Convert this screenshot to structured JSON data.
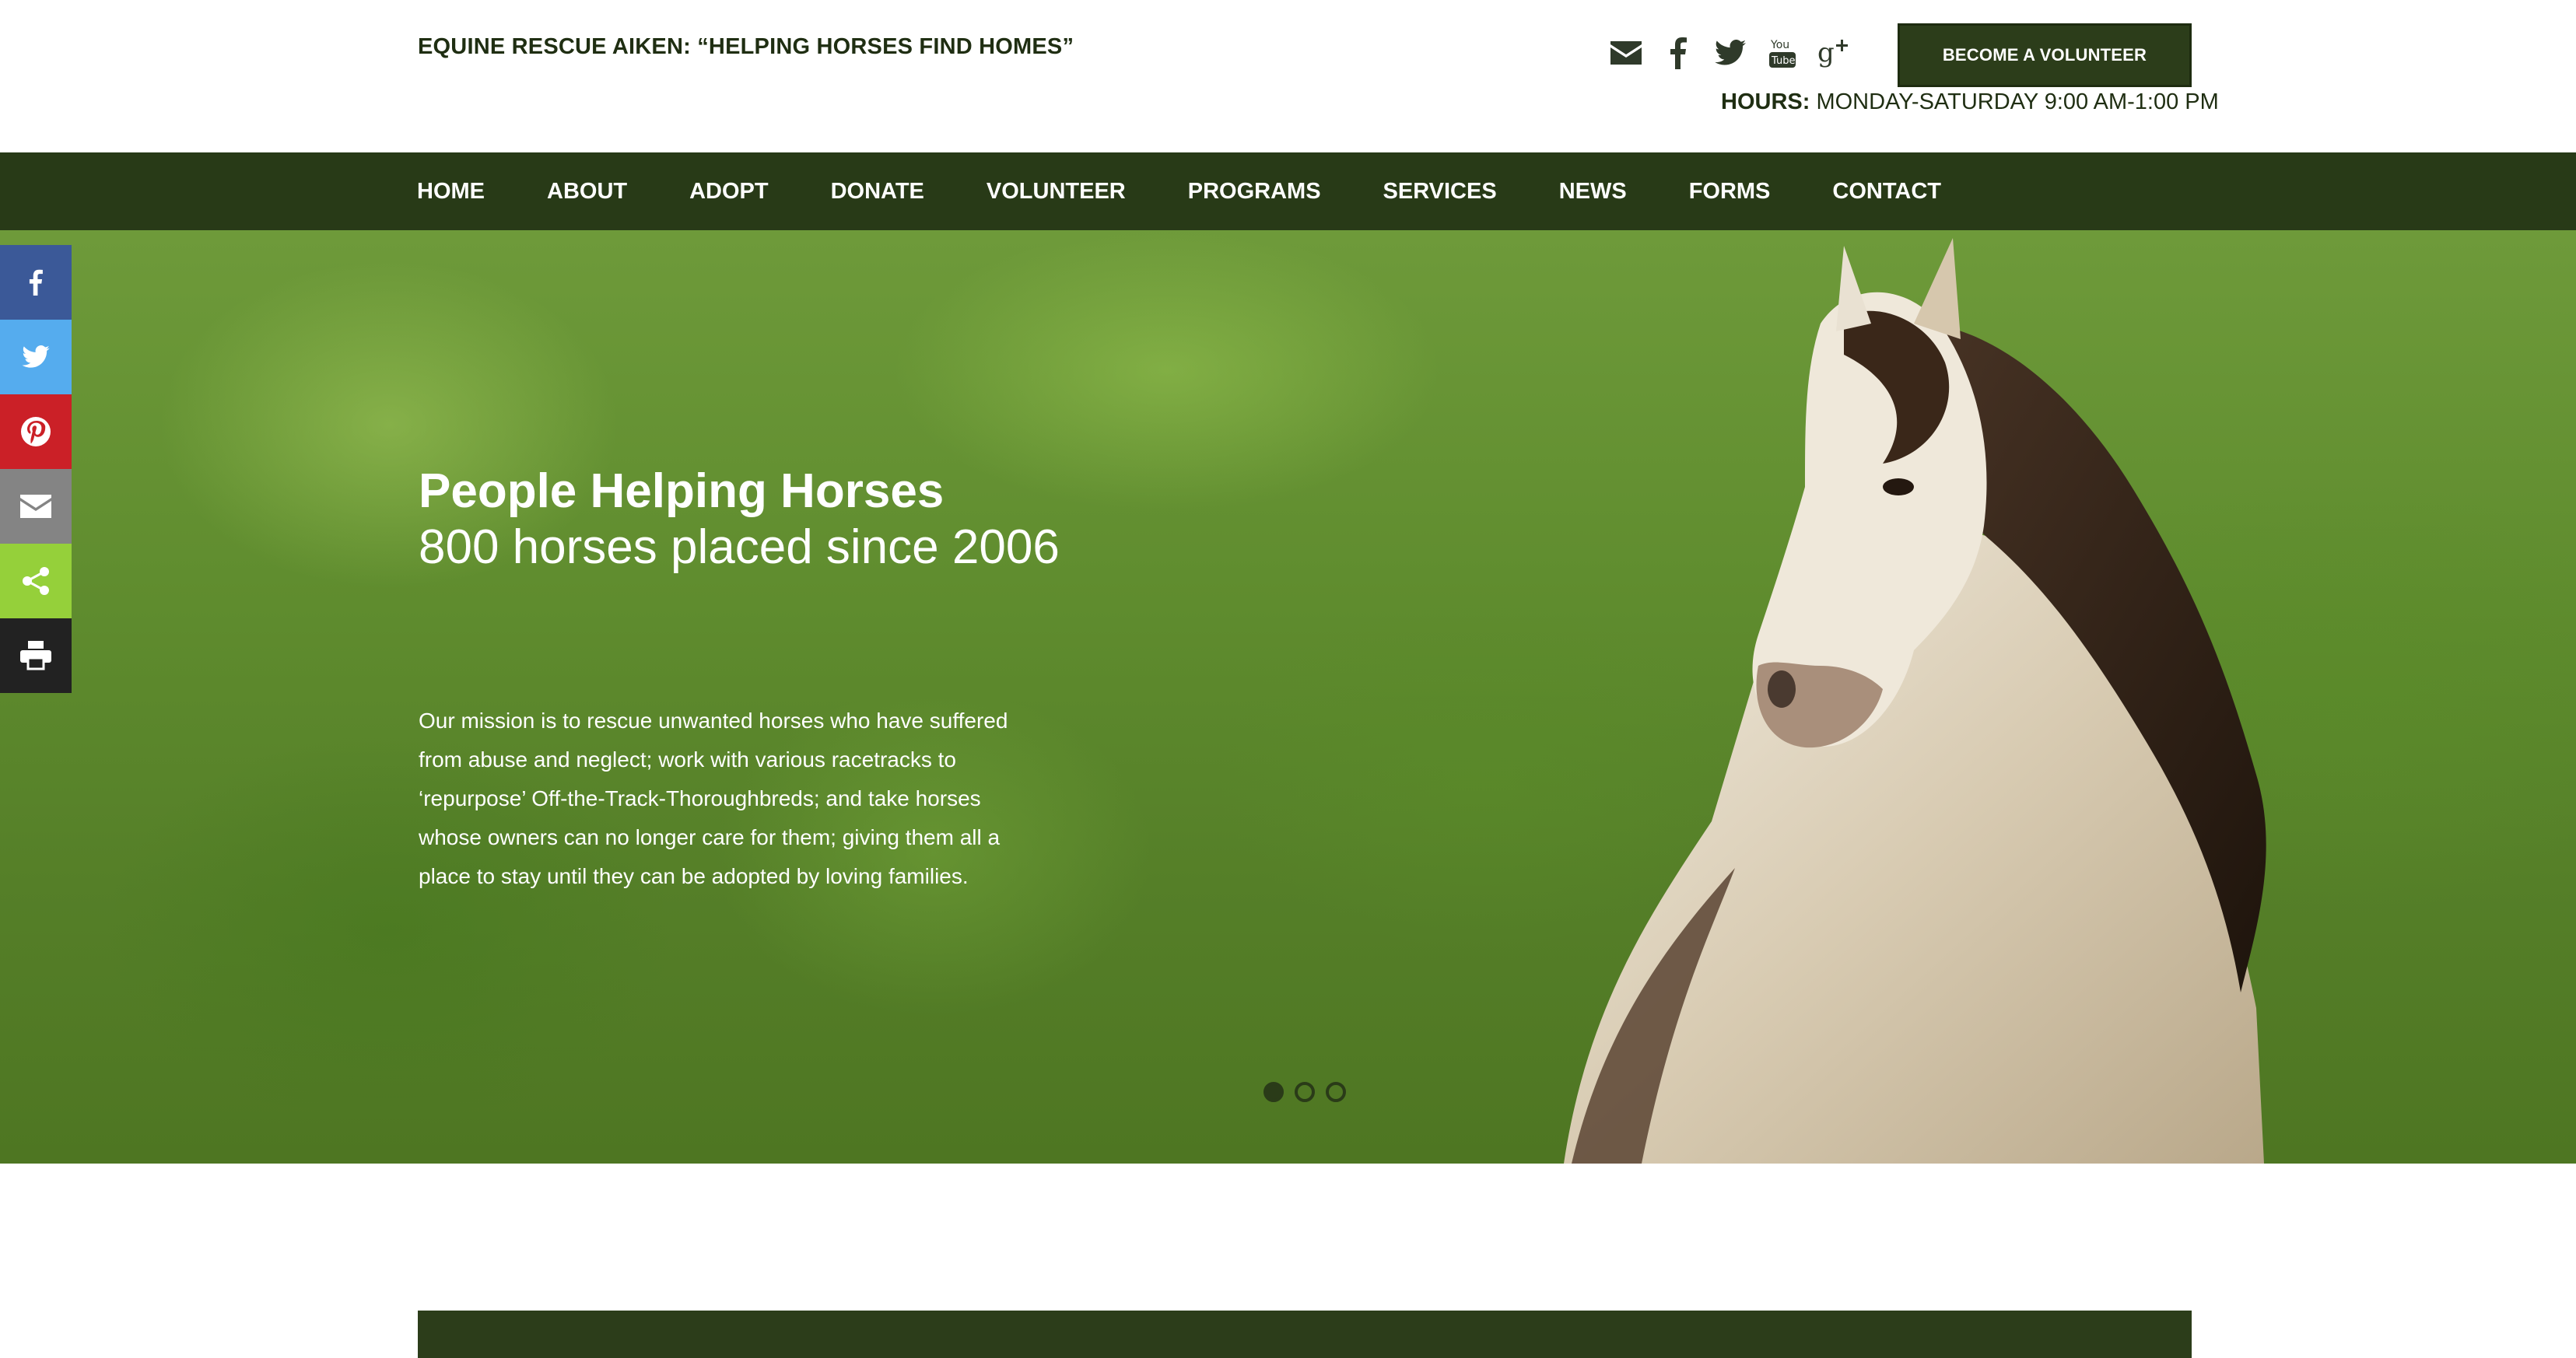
{
  "header": {
    "tagline": "EQUINE RESCUE AIKEN: “HELPING HORSES FIND HOMES”",
    "volunteer_button": "BECOME A VOLUNTEER",
    "hours_label": "HOURS:",
    "hours_value": "MONDAY-SATURDAY 9:00 AM-1:00 PM",
    "social_icons": [
      "email-icon",
      "facebook-icon",
      "twitter-icon",
      "youtube-icon",
      "google-plus-icon"
    ]
  },
  "nav": {
    "items": [
      "HOME",
      "ABOUT",
      "ADOPT",
      "DONATE",
      "VOLUNTEER",
      "PROGRAMS",
      "SERVICES",
      "NEWS",
      "FORMS",
      "CONTACT"
    ]
  },
  "hero": {
    "title": "People Helping Horses",
    "subtitle": "800 horses placed since 2006",
    "text": "Our mission is to rescue unwanted horses who have suffered from abuse and neglect; work with various racetracks to ‘repurpose’ Off-the-Track-Thoroughbreds; and take horses whose owners can no longer care for them; giving them all a place to stay until they can be adopted by loving families.",
    "slides_total": 3,
    "active_slide": 1
  },
  "share_bar": {
    "buttons": [
      {
        "name": "facebook",
        "color": "#3b5998"
      },
      {
        "name": "twitter",
        "color": "#55acee"
      },
      {
        "name": "pinterest",
        "color": "#cb2027"
      },
      {
        "name": "email",
        "color": "#848484"
      },
      {
        "name": "share",
        "color": "#95d03a"
      },
      {
        "name": "print",
        "color": "#222222"
      }
    ]
  },
  "colors": {
    "brand_green": "#283a17",
    "text_dark": "#1f2e12"
  }
}
